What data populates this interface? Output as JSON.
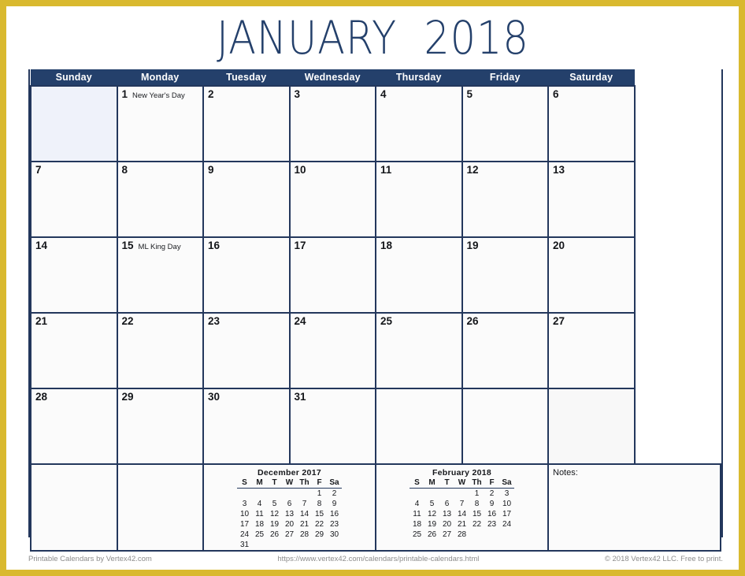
{
  "title": "JANUARY  2018",
  "weekday_headers": [
    "Sunday",
    "Monday",
    "Tuesday",
    "Wednesday",
    "Thursday",
    "Friday",
    "Saturday"
  ],
  "colors": {
    "frame": "#d9b92f",
    "header_bg": "#24406b",
    "grid_line": "#23375c",
    "title_text": "#24406b",
    "weekend_bg": "#eef2fa",
    "weekday_bg": "#fbfbfb",
    "blank_bg": "#f8f8f8",
    "footer_text": "#8d8d8d"
  },
  "weeks": [
    [
      {
        "day": "",
        "holiday": "",
        "blank": true
      },
      {
        "day": "1",
        "holiday": "New Year's Day",
        "blank": false
      },
      {
        "day": "2",
        "holiday": "",
        "blank": false
      },
      {
        "day": "3",
        "holiday": "",
        "blank": false
      },
      {
        "day": "4",
        "holiday": "",
        "blank": false
      },
      {
        "day": "5",
        "holiday": "",
        "blank": false
      },
      {
        "day": "6",
        "holiday": "",
        "blank": false
      }
    ],
    [
      {
        "day": "7",
        "holiday": "",
        "blank": false
      },
      {
        "day": "8",
        "holiday": "",
        "blank": false
      },
      {
        "day": "9",
        "holiday": "",
        "blank": false
      },
      {
        "day": "10",
        "holiday": "",
        "blank": false
      },
      {
        "day": "11",
        "holiday": "",
        "blank": false
      },
      {
        "day": "12",
        "holiday": "",
        "blank": false
      },
      {
        "day": "13",
        "holiday": "",
        "blank": false
      }
    ],
    [
      {
        "day": "14",
        "holiday": "",
        "blank": false
      },
      {
        "day": "15",
        "holiday": "ML King Day",
        "blank": false
      },
      {
        "day": "16",
        "holiday": "",
        "blank": false
      },
      {
        "day": "17",
        "holiday": "",
        "blank": false
      },
      {
        "day": "18",
        "holiday": "",
        "blank": false
      },
      {
        "day": "19",
        "holiday": "",
        "blank": false
      },
      {
        "day": "20",
        "holiday": "",
        "blank": false
      }
    ],
    [
      {
        "day": "21",
        "holiday": "",
        "blank": false
      },
      {
        "day": "22",
        "holiday": "",
        "blank": false
      },
      {
        "day": "23",
        "holiday": "",
        "blank": false
      },
      {
        "day": "24",
        "holiday": "",
        "blank": false
      },
      {
        "day": "25",
        "holiday": "",
        "blank": false
      },
      {
        "day": "26",
        "holiday": "",
        "blank": false
      },
      {
        "day": "27",
        "holiday": "",
        "blank": false
      }
    ],
    [
      {
        "day": "28",
        "holiday": "",
        "blank": false
      },
      {
        "day": "29",
        "holiday": "",
        "blank": false
      },
      {
        "day": "30",
        "holiday": "",
        "blank": false
      },
      {
        "day": "31",
        "holiday": "",
        "blank": false
      },
      {
        "day": "",
        "holiday": "",
        "blank": true
      },
      {
        "day": "",
        "holiday": "",
        "blank": true
      },
      {
        "day": "",
        "holiday": "",
        "blank": true
      }
    ]
  ],
  "mini_calendars": [
    {
      "title": "December 2017",
      "headers": [
        "S",
        "M",
        "T",
        "W",
        "Th",
        "F",
        "Sa"
      ],
      "weeks": [
        [
          "",
          "",
          "",
          "",
          "",
          "1",
          "2"
        ],
        [
          "3",
          "4",
          "5",
          "6",
          "7",
          "8",
          "9"
        ],
        [
          "10",
          "11",
          "12",
          "13",
          "14",
          "15",
          "16"
        ],
        [
          "17",
          "18",
          "19",
          "20",
          "21",
          "22",
          "23"
        ],
        [
          "24",
          "25",
          "26",
          "27",
          "28",
          "29",
          "30"
        ],
        [
          "31",
          "",
          "",
          "",
          "",
          "",
          ""
        ]
      ]
    },
    {
      "title": "February 2018",
      "headers": [
        "S",
        "M",
        "T",
        "W",
        "Th",
        "F",
        "Sa"
      ],
      "weeks": [
        [
          "",
          "",
          "",
          "",
          "1",
          "2",
          "3"
        ],
        [
          "4",
          "5",
          "6",
          "7",
          "8",
          "9",
          "10"
        ],
        [
          "11",
          "12",
          "13",
          "14",
          "15",
          "16",
          "17"
        ],
        [
          "18",
          "19",
          "20",
          "21",
          "22",
          "23",
          "24"
        ],
        [
          "25",
          "26",
          "27",
          "28",
          "",
          "",
          ""
        ]
      ]
    }
  ],
  "notes_label": "Notes:",
  "footer": {
    "left": "Printable Calendars by Vertex42.com",
    "middle": "https://www.vertex42.com/calendars/printable-calendars.html",
    "right": "© 2018 Vertex42 LLC. Free to print."
  }
}
